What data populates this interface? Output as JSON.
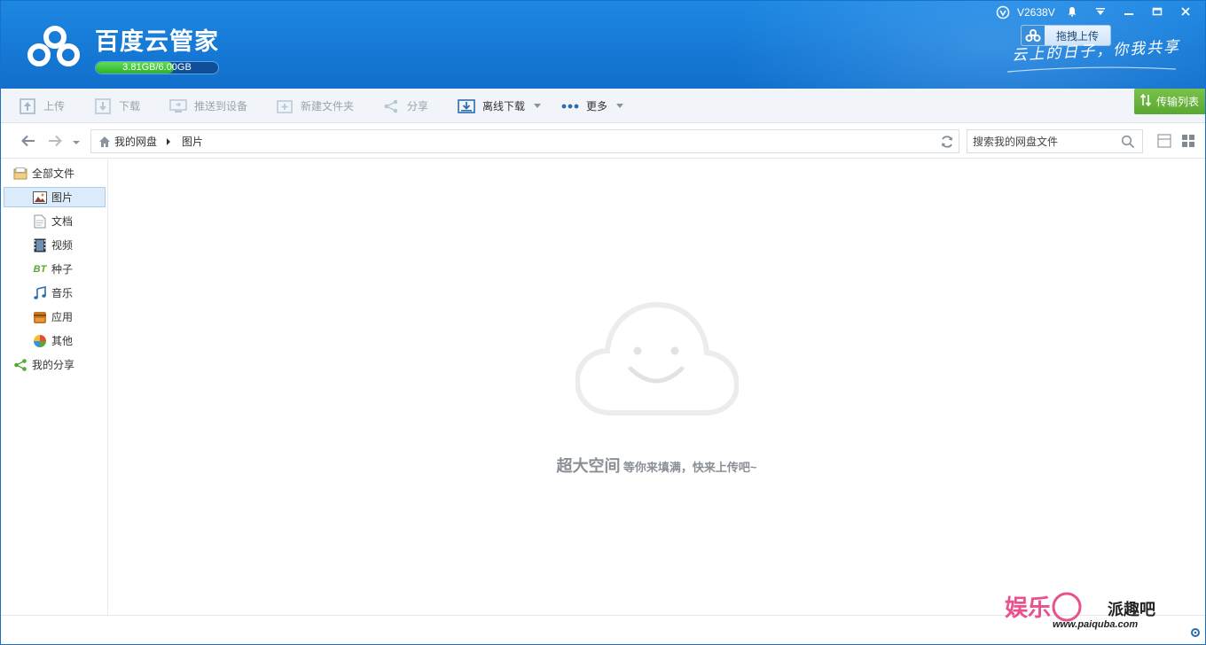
{
  "app": {
    "title": "百度云管家",
    "quota_text": "3.81GB/6.00GB",
    "quota_fraction": 0.635,
    "username": "V2638V",
    "drag_upload_label": "拖拽上传",
    "slogan": "云上的日子，你我共享",
    "transfer_list_label": "传输列表"
  },
  "window_controls": {
    "bell": "bell-icon",
    "menu": "menu-icon",
    "minimize": "minimize-icon",
    "maximize": "maximize-icon",
    "close": "close-icon"
  },
  "toolbar": {
    "upload": "上传",
    "download": "下载",
    "push_device": "推送到设备",
    "new_folder": "新建文件夹",
    "share": "分享",
    "offline_download": "离线下载",
    "more": "更多"
  },
  "nav": {
    "crumb_root": "我的网盘",
    "crumb_current": "图片",
    "search_placeholder": "搜索我的网盘文件"
  },
  "sidebar": {
    "all_files": "全部文件",
    "items": [
      {
        "label": "图片",
        "icon": "image-icon"
      },
      {
        "label": "文档",
        "icon": "document-icon"
      },
      {
        "label": "视频",
        "icon": "video-icon"
      },
      {
        "label": "种子",
        "icon": "bt-icon"
      },
      {
        "label": "音乐",
        "icon": "music-icon"
      },
      {
        "label": "应用",
        "icon": "app-icon"
      },
      {
        "label": "其他",
        "icon": "other-icon"
      }
    ],
    "my_share": "我的分享",
    "bt_glyph": "BT"
  },
  "content": {
    "empty_big": "超大空间",
    "empty_small": "等你来填满，快来上传吧~"
  },
  "watermark": {
    "text": "娱乐",
    "brand": "派趣吧",
    "url": "www.paiquba.com"
  },
  "colors": {
    "header_blue": "#1578d4",
    "transfer_green": "#5aa831",
    "quota_green": "#2fb12c",
    "selected_bg": "#dcebfa"
  }
}
